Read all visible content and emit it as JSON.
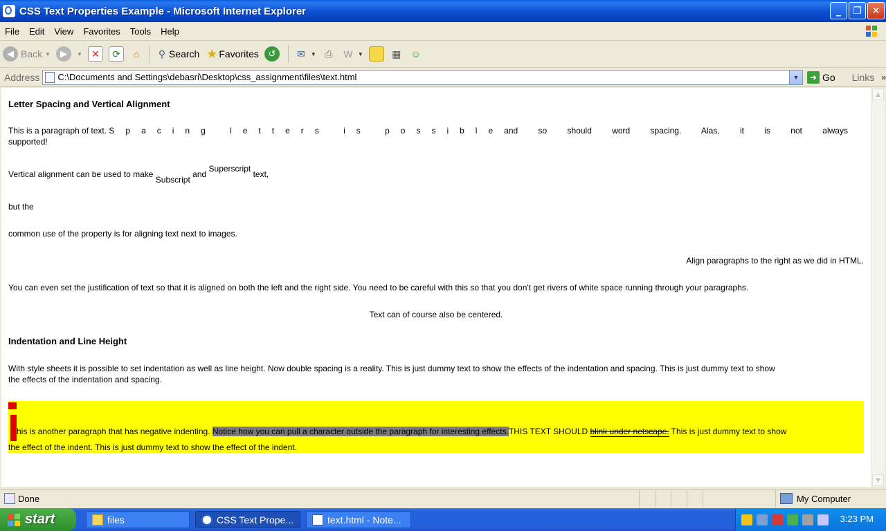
{
  "window": {
    "title": "CSS Text Properties Example - Microsoft Internet Explorer",
    "controls": {
      "minimize": "_",
      "restore": "❐",
      "close": "✕"
    }
  },
  "menu": [
    "File",
    "Edit",
    "View",
    "Favorites",
    "Tools",
    "Help"
  ],
  "toolbar": {
    "back": "Back",
    "search": "Search",
    "favorites": "Favorites"
  },
  "address": {
    "label": "Address",
    "value": "C:\\Documents and Settings\\debasri\\Desktop\\css_assignment\\files\\text.html",
    "go": "Go",
    "links": "Links"
  },
  "page": {
    "heading1": "Letter Spacing and Vertical Alignment",
    "p1_start": "This is a paragraph of text. ",
    "p1_spaced": "Spacing letters is possible",
    "p1_wordspaced": "and so should word spacing. Alas, it is not always",
    "p1_end": "supported!",
    "va_start": "Vertical alignment can be used to make ",
    "va_sub": "Subscript",
    "va_and": " and ",
    "va_sup": "Superscript",
    "va_end": " text,",
    "but_the": "but the",
    "common_use": "common use of the property is for aligning text next to images.",
    "align_right": "Align paragraphs to the right as we did in HTML.",
    "justify": "You can even set the justification of text so that it is aligned on both the left and the right side. You need to be careful with this so that you don't get rivers of white space running through your paragraphs.",
    "centered": "Text can of course also be centered.",
    "heading2": "Indentation and Line Height",
    "indent_line1": "With style sheets it is possible to set indentation as well as line height. Now double spacing is a reality. This is just dummy text to show the effects of the indentation and spacing. This is just dummy text to show",
    "indent_line2": "the effects of the indentation and spacing.",
    "neg_a": "his is another paragraph that has negative indenting. ",
    "neg_highlight": "Notice how you can pull a character outside the paragraph for interesting effects.",
    "neg_caps": "THIS TEXT SHOULD ",
    "neg_strike": "blink under netscape.",
    "neg_b": " This is just dummy text to show",
    "neg_line2": "the effect of the indent. This is just dummy text to show the effect of the indent."
  },
  "status": {
    "text": "Done",
    "zone": "My Computer"
  },
  "taskbar": {
    "start": "start",
    "tasks": [
      "files",
      "CSS Text Prope...",
      "text.html - Note..."
    ],
    "clock": "3:23 PM"
  }
}
